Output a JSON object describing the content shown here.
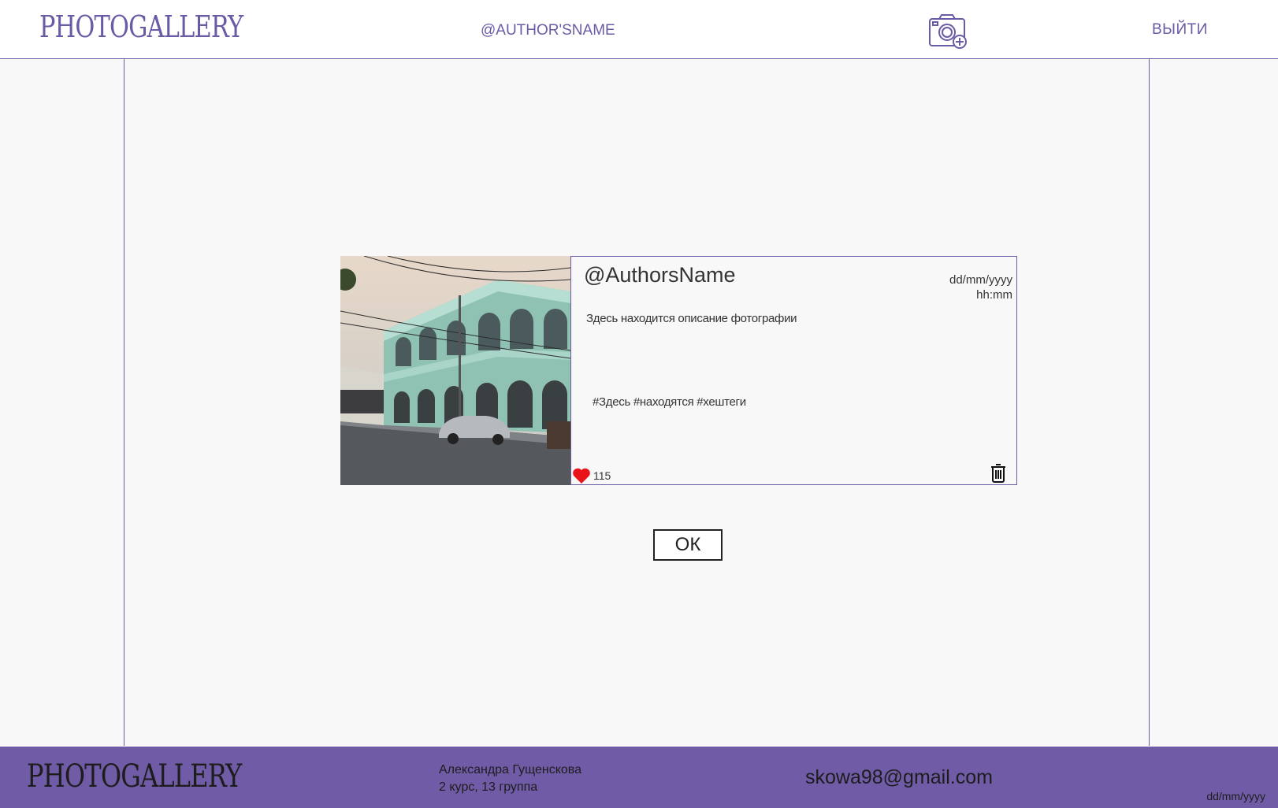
{
  "header": {
    "logo": "PHOTOGALLERY",
    "author": "@AUTHOR'SNAME",
    "add_photo_icon": "camera-add-icon",
    "logout_label": "ВЫЙТИ"
  },
  "post": {
    "author": "@AuthorsName",
    "date": "dd/mm/yyyy",
    "time": "hh:mm",
    "description": "Здесь находится описание фотографии",
    "hashtags": "#Здесь #находятся #хештеги",
    "likes": "115",
    "like_icon": "heart-icon",
    "delete_icon": "trash-icon"
  },
  "dialog": {
    "ok_label": "ОК"
  },
  "footer": {
    "logo": "PHOTOGALLERY",
    "student_name": "Александра Гущенскова",
    "student_group": "2 курс, 13 группа",
    "email": "skowa98@gmail.com",
    "date": "dd/mm/yyyy"
  },
  "colors": {
    "accent": "#6b5aa6",
    "footer_bg": "#6f5ba6",
    "background": "#f8f8f8",
    "heart": "#e8141a"
  }
}
